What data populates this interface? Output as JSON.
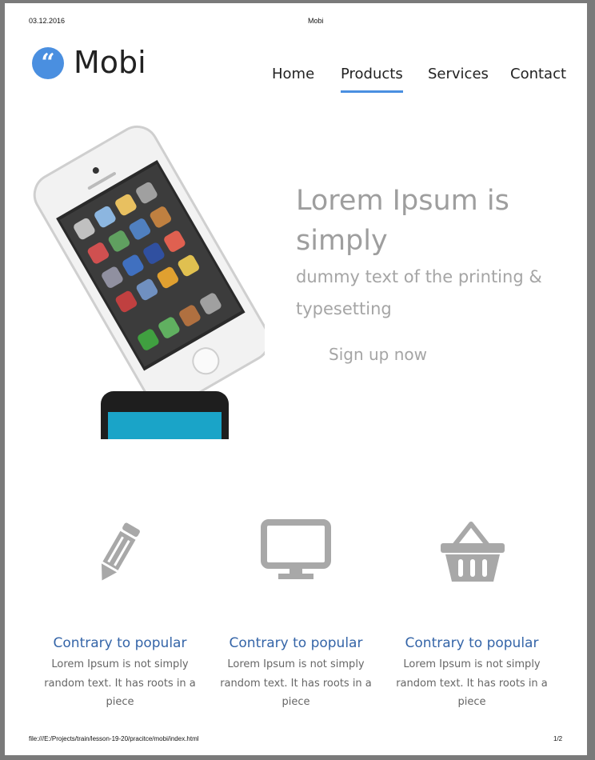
{
  "print": {
    "date": "03.12.2016",
    "title": "Mobi",
    "url": "file:///E:/Projects/train/lesson-19-20/pracitce/mobi/index.html",
    "page": "1/2"
  },
  "brand": {
    "mark": "“",
    "name": "Mobi",
    "color": "#4a8fe0"
  },
  "nav": {
    "items": [
      "Home",
      "Products",
      "Services",
      "Contact"
    ],
    "active": "Products"
  },
  "hero": {
    "heading": "Lorem Ipsum is simply",
    "subheading": "dummy text of the printing & typesetting",
    "cta": "Sign up now"
  },
  "features": [
    {
      "icon": "pencil-icon",
      "title": "Contrary to popular",
      "text": "Lorem Ipsum is not simply random text. It has roots in a piece"
    },
    {
      "icon": "monitor-icon",
      "title": "Contrary to popular",
      "text": "Lorem Ipsum is not simply random text. It has roots in a piece"
    },
    {
      "icon": "basket-icon",
      "title": "Contrary to popular",
      "text": "Lorem Ipsum is not simply random text. It has roots in a piece"
    }
  ],
  "colors": {
    "accent": "#4a8fe0",
    "feature_title": "#3565a8",
    "hero_text": "#9e9e9e",
    "icon_gray": "#a8a8a8"
  }
}
